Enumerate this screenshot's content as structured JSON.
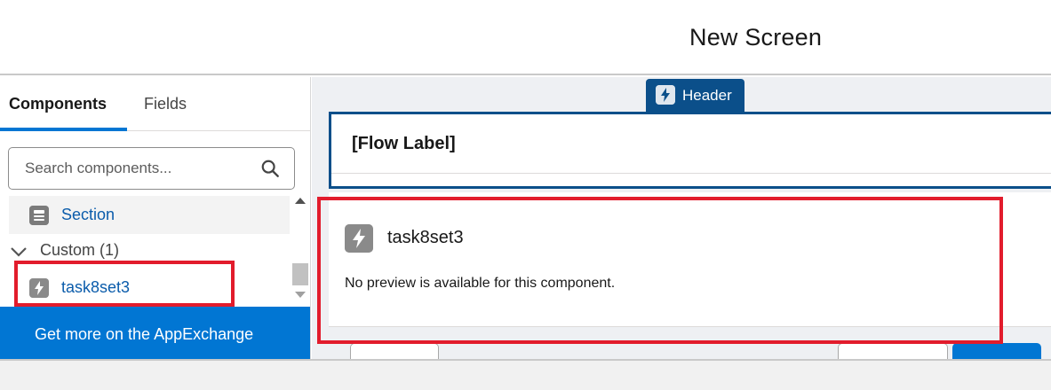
{
  "screen": {
    "title": "New Screen"
  },
  "left_panel": {
    "tabs": [
      {
        "label": "Components",
        "active": true
      },
      {
        "label": "Fields",
        "active": false
      }
    ],
    "search": {
      "placeholder": "Search components..."
    },
    "items": {
      "section_label": "Section",
      "custom_group_label": "Custom (1)",
      "custom_item_label": "task8set3"
    },
    "appexchange_label": "Get more on the AppExchange"
  },
  "canvas": {
    "header_tab_label": "Header",
    "flow_label": "[Flow Label]",
    "component": {
      "title": "task8set3",
      "description": "No preview is available for this component."
    }
  },
  "colors": {
    "accent": "#0176d3",
    "header_border": "#0b4f8a",
    "highlight": "#e21c2c",
    "link": "#0b5cab"
  },
  "icons": {
    "search": "search-icon",
    "section": "section-icon",
    "chevron": "chevron-down-icon",
    "component": "lightning-bolt-icon"
  }
}
